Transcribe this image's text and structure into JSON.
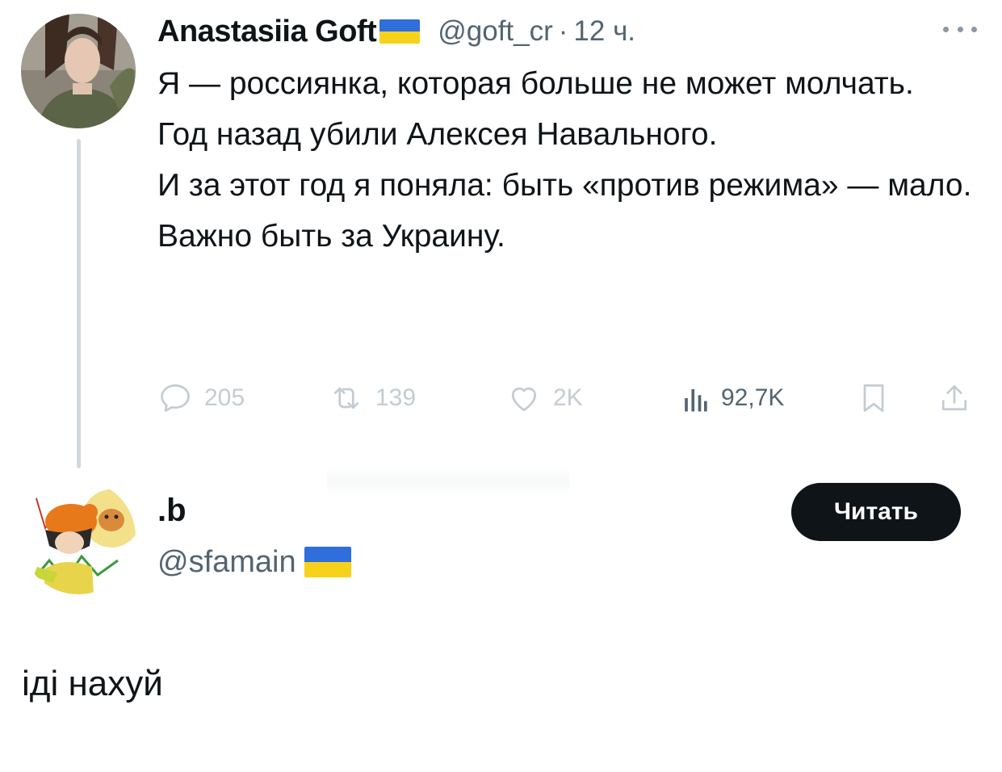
{
  "parent_tweet": {
    "author_name": "Anastasiia Goft",
    "handle": "@goft_cr",
    "separator": "·",
    "time": "12 ч.",
    "text_lines": [
      "Я — россиянка, которая больше не может молчать.",
      "Год назад убили Алексея Навального.",
      "И за этот год я поняла: быть «против режима» — мало.",
      "Важно быть за Украину."
    ],
    "actions": {
      "replies": "205",
      "retweets": "139",
      "likes": "2K",
      "views": "92,7K"
    },
    "icons": [
      "more-icon",
      "reply-icon",
      "retweet-icon",
      "like-icon",
      "views-icon",
      "bookmark-icon",
      "share-icon"
    ]
  },
  "reply": {
    "author_name": ".b",
    "handle": "@sfamain",
    "follow_label": "Читать",
    "text": "іді нахуй"
  },
  "colors": {
    "text_primary": "#0f1419",
    "text_secondary": "#536471",
    "action_faded": "#c4ccd3",
    "flag_blue": "#2f6fdc",
    "flag_yellow": "#f7d21b",
    "thread_line": "#cfd9de"
  }
}
